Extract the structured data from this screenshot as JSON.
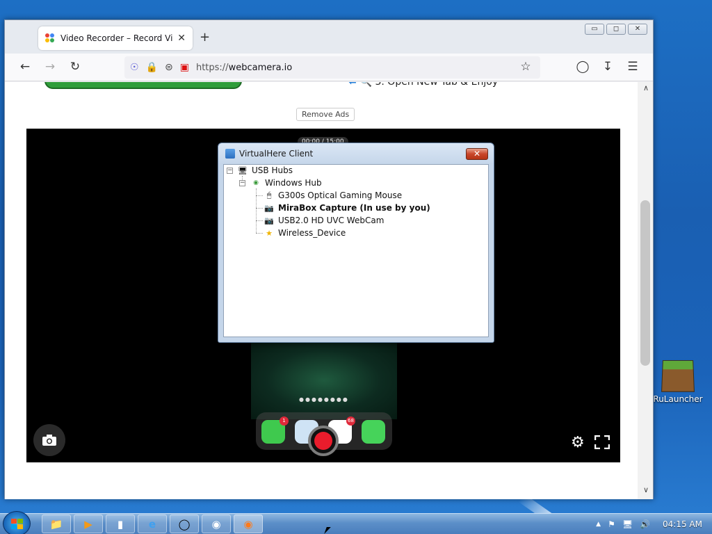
{
  "desktop": {
    "icons": [
      {
        "label": "RuLauncher",
        "icon": "minecraft-grass-block-icon"
      }
    ]
  },
  "browser": {
    "tab": {
      "title": "Video Recorder – Record Video",
      "close": "✕"
    },
    "new_tab": "+",
    "url": {
      "scheme": "https://",
      "host": "webcamera.io"
    },
    "window_buttons": [
      "▭",
      "◻",
      "✕"
    ]
  },
  "page": {
    "step_text": "3. Open New Tab & Enjoy",
    "remove_ads": "Remove Ads",
    "timer": "00:00 / 15:00",
    "phone_badges": {
      "phone": "1",
      "mail": "68"
    }
  },
  "virtualhere": {
    "title": "VirtualHere Client",
    "close": "✕",
    "tree": {
      "root": "USB Hubs",
      "hub": "Windows Hub",
      "devices": [
        {
          "label": "G300s Optical Gaming Mouse",
          "icon": "mouse-icon",
          "bold": false
        },
        {
          "label": "MiraBox Capture (In use by you)",
          "icon": "webcam-icon",
          "bold": true
        },
        {
          "label": "USB2.0 HD UVC WebCam",
          "icon": "webcam-icon",
          "bold": false
        },
        {
          "label": "Wireless_Device",
          "icon": "star-icon",
          "bold": false
        }
      ]
    }
  },
  "taskbar": {
    "clock": "04:15 AM",
    "tray_arrow": "▲"
  },
  "colors": {
    "record_red": "#ea1c2c",
    "browser_bg": "#f9f9fb",
    "desktop_blue": "#1b63b9"
  }
}
